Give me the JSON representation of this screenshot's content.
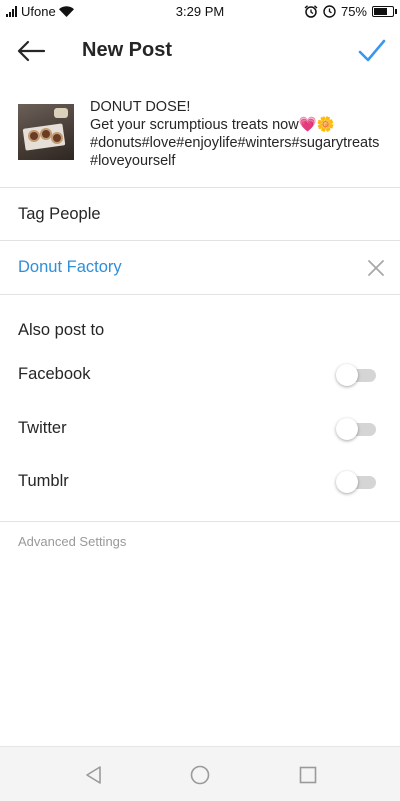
{
  "status_bar": {
    "carrier": "Ufone",
    "time": "3:29 PM",
    "battery_percent": "75%",
    "battery_level": 0.75,
    "icons": [
      "signal-icon",
      "wifi-icon",
      "alarm-icon",
      "clock-icon",
      "battery-icon"
    ]
  },
  "header": {
    "title": "New Post",
    "back_icon": "arrow-left-icon",
    "confirm_icon": "checkmark-icon",
    "accent_color": "#3897f0"
  },
  "post": {
    "caption": "DONUT DOSE!\nGet your scrumptious treats now💗🌼\n#donuts#love#enjoylife#winters#sugarytreats#loveyourself"
  },
  "tag_people": {
    "label": "Tag People"
  },
  "location": {
    "label": "Donut Factory",
    "remove_icon": "close-icon",
    "color": "#2f8fd8"
  },
  "share": {
    "heading": "Also post to",
    "options": [
      {
        "label": "Facebook",
        "enabled": false
      },
      {
        "label": "Twitter",
        "enabled": false
      },
      {
        "label": "Tumblr",
        "enabled": false
      }
    ]
  },
  "advanced": {
    "label": "Advanced Settings"
  },
  "nav_bar": {
    "icons": [
      "back-triangle-icon",
      "home-circle-icon",
      "recents-square-icon"
    ]
  }
}
